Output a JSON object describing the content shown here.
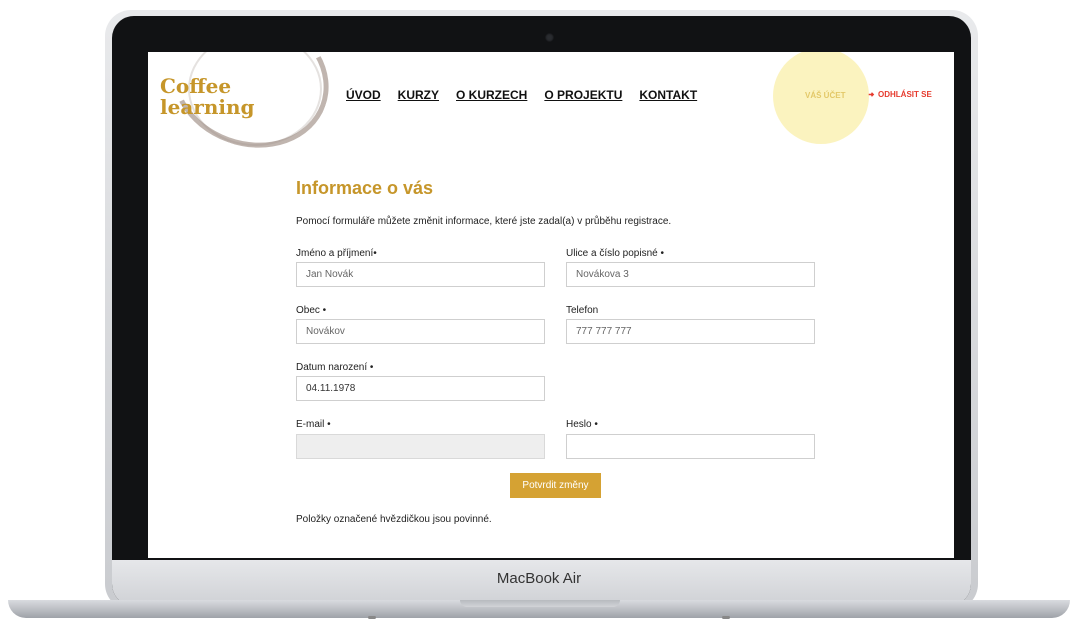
{
  "device": {
    "model": "MacBook Air"
  },
  "site": {
    "logo_line1": "Coffee",
    "logo_line2": "learning",
    "nav": [
      "ÚVOD",
      "KURZY",
      "O KURZECH",
      "O PROJEKTU",
      "KONTAKT"
    ],
    "account_label": "VÁŠ ÚČET",
    "logout_label": "ODHLÁSIT SE",
    "logout_icon": "logout-icon"
  },
  "form": {
    "title": "Informace o vás",
    "intro": "Pomocí formuláře můžete změnit informace, které jste zadal(a) v průběhu registrace.",
    "fields": {
      "name": {
        "label": "Jméno a příjmení•",
        "value": "Jan Novák"
      },
      "street": {
        "label": "Ulice a číslo popisné •",
        "value": "Novákova 3"
      },
      "city": {
        "label": "Obec •",
        "value": "Novákov"
      },
      "phone": {
        "label": "Telefon",
        "value": "777 777 777"
      },
      "birth": {
        "label": "Datum narození •",
        "value": "04.11.1978"
      },
      "email": {
        "label": "E-mail •",
        "value": ""
      },
      "password": {
        "label": "Heslo •",
        "value": ""
      }
    },
    "submit_label": "Potvrdit změny",
    "required_note": "Položky označené hvězdičkou jsou povinné."
  },
  "colors": {
    "accent": "#d5a233",
    "logout": "#e63b2e"
  }
}
